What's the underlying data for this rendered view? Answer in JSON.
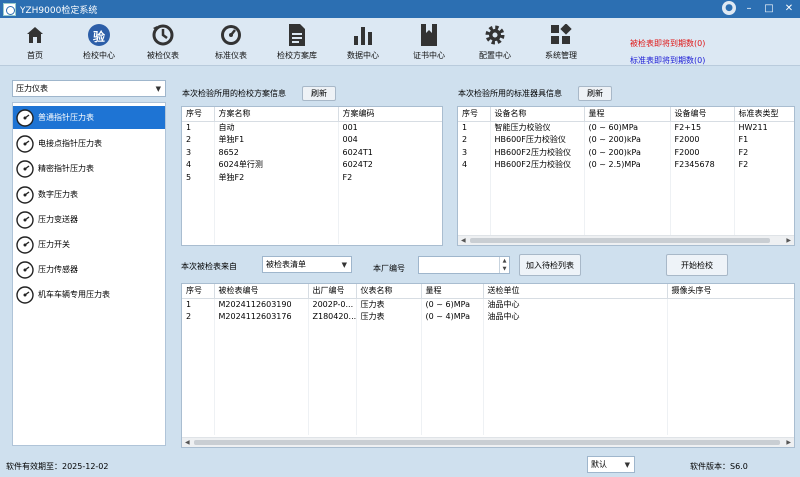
{
  "window": {
    "title": "YZH9000检定系统"
  },
  "toolbar": {
    "items": [
      {
        "label": "首页",
        "icon": "home-icon"
      },
      {
        "label": "检校中心",
        "icon": "verify-badge-icon",
        "glyph": "验"
      },
      {
        "label": "被检仪表",
        "icon": "dial-refresh-icon"
      },
      {
        "label": "标准仪表",
        "icon": "speedometer-icon"
      },
      {
        "label": "检校方案库",
        "icon": "document-icon"
      },
      {
        "label": "数据中心",
        "icon": "bar-chart-icon"
      },
      {
        "label": "证书中心",
        "icon": "certificate-book-icon"
      },
      {
        "label": "配置中心",
        "icon": "gear-icon"
      },
      {
        "label": "系统管理",
        "icon": "apps-grid-icon"
      }
    ],
    "notice_expiring_inspected": "被检表即将到期数(0)",
    "notice_expiring_standard": "标准表即将到期数(0)"
  },
  "sidebar": {
    "category": "压力仪表",
    "items": [
      {
        "label": "普通指针压力表",
        "selected": true
      },
      {
        "label": "电接点指针压力表"
      },
      {
        "label": "精密指针压力表"
      },
      {
        "label": "数字压力表"
      },
      {
        "label": "压力变送器"
      },
      {
        "label": "压力开关"
      },
      {
        "label": "压力传感器"
      },
      {
        "label": "机车车辆专用压力表"
      }
    ]
  },
  "plans": {
    "title": "本次检验所用的检校方案信息",
    "refresh": "刷新",
    "columns": [
      "序号",
      "方案名称",
      "方案编码"
    ],
    "rows": [
      [
        "1",
        "自动",
        "001"
      ],
      [
        "2",
        "单独F1",
        "004"
      ],
      [
        "3",
        "8652",
        "6024T1"
      ],
      [
        "4",
        "6024单行测",
        "6024T2"
      ],
      [
        "5",
        "单独F2",
        "F2"
      ]
    ]
  },
  "standards": {
    "title": "本次检验所用的标准器具信息",
    "refresh": "刷新",
    "columns": [
      "序号",
      "设备名称",
      "量程",
      "设备编号",
      "标准表类型"
    ],
    "rows": [
      [
        "1",
        "智能压力校验仪",
        "(0 ~ 60)MPa",
        "F2+15",
        "HW211"
      ],
      [
        "2",
        "HB600F压力校验仪",
        "(0 ~ 200)kPa",
        "F2000",
        "F1"
      ],
      [
        "3",
        "HB600F2压力校验仪",
        "(0 ~ 200)kPa",
        "F2000",
        "F2"
      ],
      [
        "4",
        "HB600F2压力校验仪",
        "(0 ~ 2.5)MPa",
        "F2345678",
        "F2"
      ]
    ]
  },
  "source": {
    "label": "本次被检表来自",
    "value": "被检表清单",
    "factory_label": "本厂编号",
    "factory_value": "",
    "add_button": "加入待检列表",
    "start_button": "开始检校"
  },
  "queue": {
    "columns": [
      "序号",
      "被检表编号",
      "出厂编号",
      "仪表名称",
      "量程",
      "送检单位",
      "摄像头序号"
    ],
    "rows": [
      [
        "1",
        "M2024112603190",
        "2002P-0...",
        "压力表",
        "(0 ~ 6)MPa",
        "油品中心",
        ""
      ],
      [
        "2",
        "M2024112603176",
        "Z180420...",
        "压力表",
        "(0 ~ 4)MPa",
        "油品中心",
        ""
      ]
    ]
  },
  "status": {
    "expiry": "软件有效期至：2025-12-02",
    "mode": "默认",
    "version": "软件版本：S6.0"
  },
  "colors": {
    "accent": "#1e74d4",
    "titlebar": "#2c6fb2",
    "alert_red": "#e01616",
    "alert_blue": "#1b1bd6"
  }
}
